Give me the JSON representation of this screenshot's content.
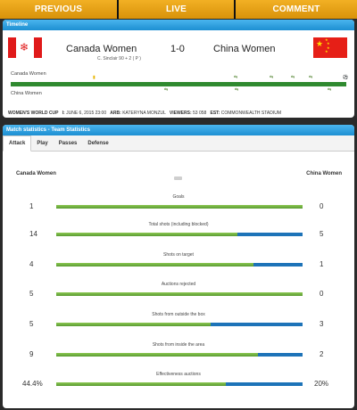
{
  "nav": {
    "previous": "PREVIOUS",
    "live": "LIVE",
    "comment": "COMMENT"
  },
  "timeline": {
    "header": "Timeline",
    "home_team": "Canada Women",
    "away_team": "China Women",
    "score": "1-0",
    "scorer": "C. Sinclair 90 + 2 ( P )",
    "timeline_home_label": "Canada Women",
    "timeline_away_label": "China Women",
    "info": {
      "competition": "WOMEN'S WORLD CUP",
      "date_label": "I:",
      "date": "JUNE 6, 2015 23:00",
      "referee_label": "ARB:",
      "referee": "KATERYNA MONZUL",
      "viewers_label": "VIEWERS:",
      "viewers": "53 058",
      "stadium_label": "EST:",
      "stadium": "COMMONWEALTH STADIUM"
    }
  },
  "stats": {
    "header": "Match statistics - Team Statistics",
    "tabs": [
      "Attack",
      "Play",
      "Passes",
      "Defense"
    ],
    "active_tab": "Attack",
    "left_team": "Canada Women",
    "right_team": "China Women",
    "rows": [
      {
        "label": "Goals",
        "left": "1",
        "right": "0",
        "left_share": 1.0
      },
      {
        "label": "Total shots (including blocked)",
        "left": "14",
        "right": "5",
        "left_share": 0.737
      },
      {
        "label": "Shots on target",
        "left": "4",
        "right": "1",
        "left_share": 0.8
      },
      {
        "label": "Auctions rejected",
        "left": "5",
        "right": "0",
        "left_share": 1.0
      },
      {
        "label": "Shots from outside the box",
        "left": "5",
        "right": "3",
        "left_share": 0.625
      },
      {
        "label": "Shots from inside the area",
        "left": "9",
        "right": "2",
        "left_share": 0.818
      },
      {
        "label": "Effectiveness auctions",
        "left": "44.4%",
        "right": "20%",
        "left_share": 0.69
      }
    ]
  },
  "colors": {
    "nav_gold": "#e8a21a",
    "header_blue": "#2a9fe0",
    "bar_green": "#6aaa3a",
    "bar_blue": "#1d73b8",
    "timeline_green": "#2f8a2f"
  }
}
